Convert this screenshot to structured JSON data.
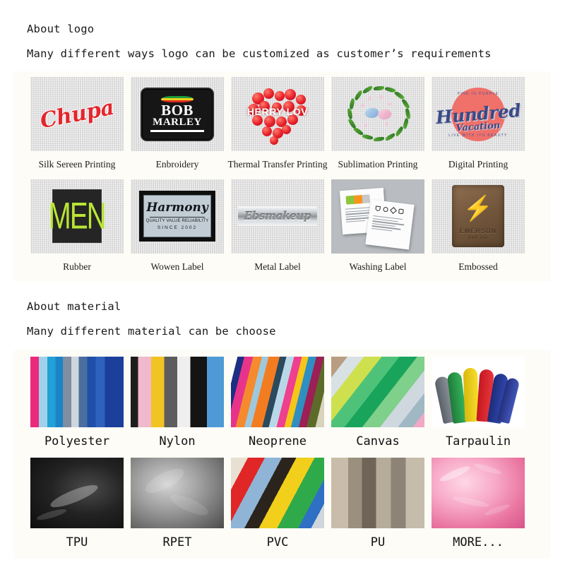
{
  "sections": [
    {
      "id": "logo",
      "title": "About logo",
      "subtitle": "Many different ways logo can be customized as customer’s requirements",
      "rows": [
        [
          {
            "label": "Silk Sereen Printing",
            "art": "chupa",
            "alt_text": "Chupa"
          },
          {
            "label": "Enbroidery",
            "art": "bobmarley",
            "alt_text": "BOB MARLEY"
          },
          {
            "label": "Thermal Transfer Printing",
            "art": "cherryheart",
            "alt_text": "HERRY LOV"
          },
          {
            "label": "Sublimation Printing",
            "art": "wreath",
            "alt_text": "floral wreath with two birds"
          },
          {
            "label": "Digital Printing",
            "art": "hundred",
            "alt_text": "Hundred Vacation"
          }
        ],
        [
          {
            "label": "Rubber",
            "art": "men",
            "alt_text": "MEN"
          },
          {
            "label": "Wowen Label",
            "art": "harmony",
            "alt_text": "Harmony"
          },
          {
            "label": "Metal Label",
            "art": "metal",
            "alt_text": "Ebsmakeup"
          },
          {
            "label": "Washing Label",
            "art": "washing",
            "alt_text": "care labels"
          },
          {
            "label": "Embossed",
            "art": "embossed",
            "alt_text": "EMERSON"
          }
        ]
      ]
    },
    {
      "id": "material",
      "title": "About material",
      "subtitle": "Many different material can be choose",
      "rows": [
        [
          {
            "label": "Polyester",
            "art": "poly"
          },
          {
            "label": "Nylon",
            "art": "nylon"
          },
          {
            "label": "Neoprene",
            "art": "neo"
          },
          {
            "label": "Canvas",
            "art": "canvas"
          },
          {
            "label": "Tarpaulin",
            "art": "tarp"
          }
        ],
        [
          {
            "label": "TPU",
            "art": "tpu"
          },
          {
            "label": "RPET",
            "art": "rpet"
          },
          {
            "label": "PVC",
            "art": "pvc"
          },
          {
            "label": "PU",
            "art": "pu"
          },
          {
            "label": "MORE...",
            "art": "more"
          }
        ]
      ]
    }
  ],
  "art_text": {
    "chupa": "Chupa",
    "bob_line1": "BOB",
    "bob_line2": "MARLEY",
    "cherry": "HERRY LOV",
    "hundred_top": "PINK IS PURPLE",
    "hundred_main": "Hundred",
    "hundred_sub": "Vacation",
    "hundred_bottom": "LIVE WITH ITS BEAUTY",
    "men": "MEN",
    "harmony_brand": "Harmony",
    "harmony_quality": "QUALITY VALUE RELIABILITY",
    "harmony_since": "SINCE 2002",
    "metal": "Ebsmakeup",
    "emerson_mark": "⚡",
    "emerson_name": "EMERSON",
    "emerson_sub": "EMP 250"
  },
  "colors": {
    "panel_background": "#fdfcf6",
    "page_background": "#ffffff",
    "text": "#1a1a1a",
    "chupa_red": "#e3262d",
    "men_green": "#b9e533",
    "leather_brown": "#73573c",
    "coral": "#f0706a",
    "navy": "#3a4a86"
  }
}
